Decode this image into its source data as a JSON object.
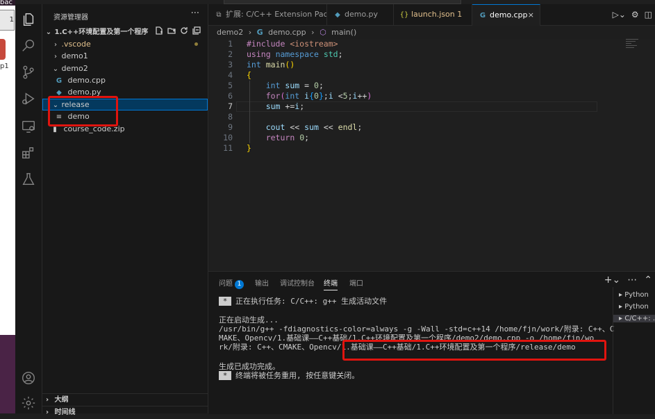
{
  "desktop": {
    "corner_tag": "bac",
    "dock_button": "1",
    "side_text": "p1"
  },
  "sidebar": {
    "title": "资源管理器",
    "more": "···",
    "root": "1.C++环境配置及第一个程序",
    "items": [
      {
        "label": ".vscode",
        "kind": "folder-collapsed",
        "color": "#e2c08d"
      },
      {
        "label": "demo1",
        "kind": "folder-collapsed"
      },
      {
        "label": "demo2",
        "kind": "folder-expanded"
      },
      {
        "label": "demo.cpp",
        "kind": "cpp-file"
      },
      {
        "label": "demo.py",
        "kind": "py-file"
      },
      {
        "label": "release",
        "kind": "folder-expanded"
      },
      {
        "label": "demo",
        "kind": "binary-file"
      },
      {
        "label": "course_code.zip",
        "kind": "zip-file"
      }
    ],
    "outline": "大纲",
    "timeline": "时间线"
  },
  "tabs": [
    {
      "label": "扩展: C/C++ Extension Pack",
      "icon": "extension-icon"
    },
    {
      "label": "demo.py",
      "icon": "python-icon"
    },
    {
      "label": "launch.json 1",
      "icon": "json-icon"
    },
    {
      "label": "demo.cpp",
      "icon": "cpp-icon",
      "active": true
    }
  ],
  "breadcrumb": [
    "demo2",
    "demo.cpp",
    "main()"
  ],
  "editor": {
    "current_line": 7,
    "line_numbers": [
      "1",
      "2",
      "3",
      "4",
      "5",
      "6",
      "7",
      "8",
      "9",
      "10",
      "11"
    ]
  },
  "panel": {
    "tabs": [
      {
        "label": "问题",
        "badge": "1"
      },
      {
        "label": "输出"
      },
      {
        "label": "调试控制台"
      },
      {
        "label": "终端",
        "active": true
      },
      {
        "label": "端口"
      }
    ],
    "terminal": [
      {
        "star": "*",
        "text": "正在执行任务: C/C++: g++ 生成活动文件"
      },
      {
        "text": "正在启动生成..."
      },
      {
        "text": "/usr/bin/g++ -fdiagnostics-color=always -g -Wall -std=c++14 /home/fjn/work/附录: C++、C"
      },
      {
        "text": "MAKE、Opencv/1.基础课——C++基础/1.C++环境配置及第一个程序/demo2/demo.cpp -o /home/fjn/wo"
      },
      {
        "text": "rk/附录: C++、CMAKE、Opencv/1.基础课——C++基础/1.C++环境配置及第一个程序/release/demo"
      },
      {
        "text": "生成已成功完成。"
      },
      {
        "star": "*",
        "text": "终端将被任务重用, 按任意键关闭。"
      }
    ],
    "terminal_list": [
      "Python",
      "Python",
      "C/C++: ..."
    ]
  },
  "colors": {
    "accent": "#0078d4",
    "highlight_box": "#e0140f"
  }
}
